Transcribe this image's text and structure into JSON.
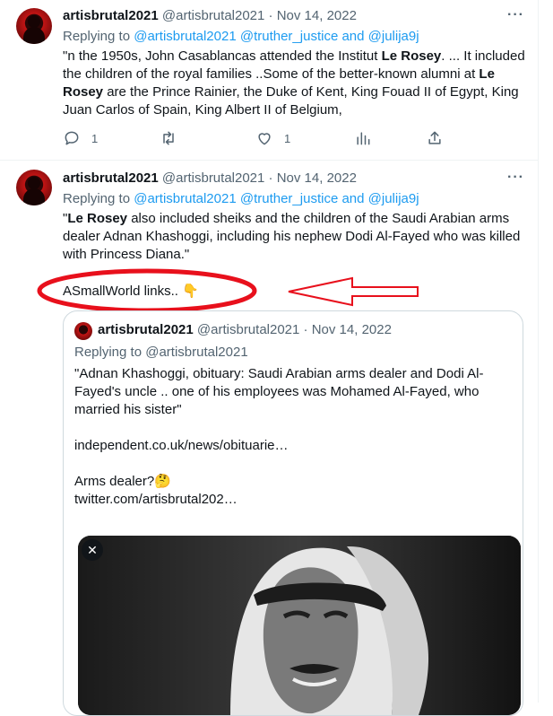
{
  "tweets": [
    {
      "name": "artisbrutal2021",
      "handle": "@artisbrutal2021",
      "sep": "·",
      "date": "Nov 14, 2022",
      "more": "···",
      "replying_prefix": "Replying to",
      "reply_handles": "@artisbrutal2021 @truther_justice and @julija9j",
      "text_1": "\"n the 1950s, John Casablancas attended the Institut ",
      "text_bold": "Le Rosey",
      "text_2": ". ... It included the children of the royal families ..Some of the better-known alumni at ",
      "text_bold_2": "Le Rosey",
      "text_3": " are the  Prince Rainier, the Duke of Kent, King Fouad II of Egypt, King Juan Carlos of Spain, King Albert II of Belgium,",
      "actions": {
        "replies": "1",
        "retweets": "",
        "likes": "1"
      }
    },
    {
      "name": "artisbrutal2021",
      "handle": "@artisbrutal2021",
      "sep": "·",
      "date": "Nov 14, 2022",
      "more": "···",
      "replying_prefix": "Replying to",
      "reply_handles": "@artisbrutal2021 @truther_justice and @julija9j",
      "text_quote_open": "\"",
      "text_bold": "Le Rosey",
      "text_1": " also included sheiks and the children of the Saudi Arabian arms dealer Adnan Khashoggi, including his nephew Dodi Al-Fayed who was killed with Princess Diana.\"",
      "text_2": "ASmallWorld links.. 👇"
    }
  ],
  "quoted": {
    "name": "artisbrutal2021",
    "handle": "@artisbrutal2021",
    "sep": "·",
    "date": "Nov 14, 2022",
    "replying": "Replying to @artisbrutal2021",
    "text_1": "\"Adnan Khashoggi, obituary: Saudi Arabian arms dealer and Dodi Al-Fayed's uncle .. one of his employees was Mohamed Al-Fayed, who married his sister\"",
    "link_1": "independent.co.uk/news/obituarie…",
    "text_2": "Arms dealer?🤔",
    "link_2": "twitter.com/artisbrutal202…",
    "close": "✕"
  },
  "colors": {
    "link": "#1d9bf0",
    "muted": "#536471",
    "annotation": "#e8101c"
  },
  "icons": [
    "reply-icon",
    "retweet-icon",
    "like-icon",
    "views-icon",
    "share-icon",
    "more-icon",
    "close-icon"
  ]
}
